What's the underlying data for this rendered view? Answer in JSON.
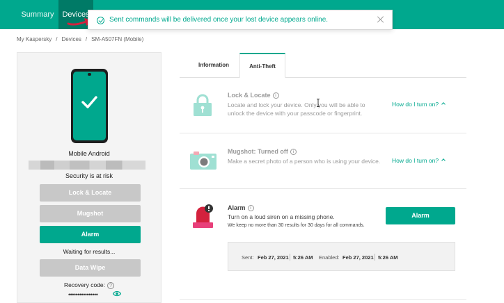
{
  "nav": {
    "tabs": [
      {
        "label": "Summary"
      },
      {
        "label": "Devices"
      }
    ]
  },
  "toast": {
    "message": "Sent commands will be delivered once your lost device appears online."
  },
  "breadcrumb": {
    "items": [
      "My Kaspersky",
      "Devices",
      "SM-A507FN (Mobile)"
    ],
    "separator": "/"
  },
  "device": {
    "name": "Mobile Android",
    "status": "Security is at risk",
    "buttons": {
      "lock": "Lock & Locate",
      "mugshot": "Mugshot",
      "alarm": "Alarm",
      "wipe": "Data Wipe"
    },
    "waiting": "Waiting for results...",
    "recovery_label": "Recovery code:",
    "recovery_masked": "••••••••••••••••"
  },
  "tabs": [
    {
      "label": "Information"
    },
    {
      "label": "Anti-Theft"
    }
  ],
  "features": {
    "lock": {
      "title": "Lock & Locate",
      "desc": "Locate and lock your device. Only you will be able to unlock the device with your passcode or fingerprint.",
      "link": "How do I turn on?"
    },
    "mugshot": {
      "title": "Mugshot: Turned off",
      "desc": "Make a secret photo of a person who is using your device.",
      "link": "How do I turn on?"
    },
    "alarm": {
      "title": "Alarm",
      "desc": "Turn on a loud siren on a missing phone.",
      "note": "We keep no more than 30 results for 30 days for all commands.",
      "button": "Alarm",
      "sent_label": "Sent:",
      "sent_date": "Feb 27, 2021",
      "sent_time": "5:26 AM",
      "enabled_label": "Enabled:",
      "enabled_date": "Feb 27, 2021",
      "enabled_time": "5:26 AM"
    }
  },
  "colors": {
    "brand": "#00a88e",
    "brand_dark": "#007a66",
    "disabled": "#c8c8c8",
    "alarm_red": "#d4213d"
  }
}
